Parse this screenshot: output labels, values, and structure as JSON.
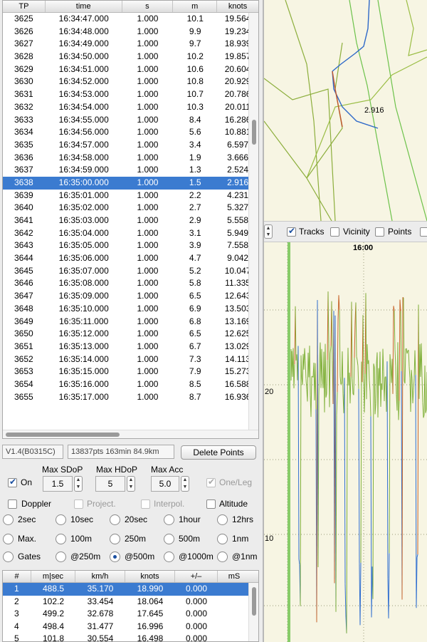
{
  "points_table": {
    "columns": [
      "TP",
      "time",
      "s",
      "m",
      "knots"
    ],
    "selected_tp": "3638",
    "rows": [
      [
        "3625",
        "16:34:47.000",
        "1.000",
        "10.1",
        "19.564"
      ],
      [
        "3626",
        "16:34:48.000",
        "1.000",
        "9.9",
        "19.234"
      ],
      [
        "3627",
        "16:34:49.000",
        "1.000",
        "9.7",
        "18.939"
      ],
      [
        "3628",
        "16:34:50.000",
        "1.000",
        "10.2",
        "19.857"
      ],
      [
        "3629",
        "16:34:51.000",
        "1.000",
        "10.6",
        "20.604"
      ],
      [
        "3630",
        "16:34:52.000",
        "1.000",
        "10.8",
        "20.929"
      ],
      [
        "3631",
        "16:34:53.000",
        "1.000",
        "10.7",
        "20.786"
      ],
      [
        "3632",
        "16:34:54.000",
        "1.000",
        "10.3",
        "20.011"
      ],
      [
        "3633",
        "16:34:55.000",
        "1.000",
        "8.4",
        "16.286"
      ],
      [
        "3634",
        "16:34:56.000",
        "1.000",
        "5.6",
        "10.881"
      ],
      [
        "3635",
        "16:34:57.000",
        "1.000",
        "3.4",
        "6.597"
      ],
      [
        "3636",
        "16:34:58.000",
        "1.000",
        "1.9",
        "3.666"
      ],
      [
        "3637",
        "16:34:59.000",
        "1.000",
        "1.3",
        "2.524"
      ],
      [
        "3638",
        "16:35:00.000",
        "1.000",
        "1.5",
        "2.916"
      ],
      [
        "3639",
        "16:35:01.000",
        "1.000",
        "2.2",
        "4.231"
      ],
      [
        "3640",
        "16:35:02.000",
        "1.000",
        "2.7",
        "5.327"
      ],
      [
        "3641",
        "16:35:03.000",
        "1.000",
        "2.9",
        "5.558"
      ],
      [
        "3642",
        "16:35:04.000",
        "1.000",
        "3.1",
        "5.949"
      ],
      [
        "3643",
        "16:35:05.000",
        "1.000",
        "3.9",
        "7.558"
      ],
      [
        "3644",
        "16:35:06.000",
        "1.000",
        "4.7",
        "9.042"
      ],
      [
        "3645",
        "16:35:07.000",
        "1.000",
        "5.2",
        "10.047"
      ],
      [
        "3646",
        "16:35:08.000",
        "1.000",
        "5.8",
        "11.335"
      ],
      [
        "3647",
        "16:35:09.000",
        "1.000",
        "6.5",
        "12.643"
      ],
      [
        "3648",
        "16:35:10.000",
        "1.000",
        "6.9",
        "13.503"
      ],
      [
        "3649",
        "16:35:11.000",
        "1.000",
        "6.8",
        "13.169"
      ],
      [
        "3650",
        "16:35:12.000",
        "1.000",
        "6.5",
        "12.625"
      ],
      [
        "3651",
        "16:35:13.000",
        "1.000",
        "6.7",
        "13.029"
      ],
      [
        "3652",
        "16:35:14.000",
        "1.000",
        "7.3",
        "14.113"
      ],
      [
        "3653",
        "16:35:15.000",
        "1.000",
        "7.9",
        "15.273"
      ],
      [
        "3654",
        "16:35:16.000",
        "1.000",
        "8.5",
        "16.588"
      ],
      [
        "3655",
        "16:35:17.000",
        "1.000",
        "8.7",
        "16.936"
      ]
    ]
  },
  "info": {
    "version": "V1.4(B0315C)",
    "stats": "13837pts 163min 84.9km",
    "delete_button": "Delete Points"
  },
  "filters": {
    "on_label": "On",
    "on_checked": true,
    "sdop_label": "Max SDoP",
    "sdop_value": "1.5",
    "hdop_label": "Max HDoP",
    "hdop_value": "5",
    "acc_label": "Max Acc",
    "acc_value": "5.0",
    "one_leg_label": "One/Leg",
    "one_leg_checked": true,
    "doppler_label": "Doppler",
    "project_label": "Project.",
    "interpol_label": "Interpol.",
    "altitude_label": "Altitude"
  },
  "radio_options": {
    "row1": [
      "2sec",
      "10sec",
      "20sec",
      "1hour",
      "12hrs"
    ],
    "row2": [
      "Max.",
      "100m",
      "250m",
      "500m",
      "1nm"
    ],
    "row3": [
      "Gates",
      "@250m",
      "@500m",
      "@1000m",
      "@1nm"
    ],
    "selected": "@500m"
  },
  "laps_table": {
    "columns": [
      "#",
      "m|sec",
      "km/h",
      "knots",
      "+/–",
      "mS"
    ],
    "rows": [
      [
        "1",
        "488.5",
        "35.170",
        "18.990",
        "0.000"
      ],
      [
        "2",
        "102.2",
        "33.454",
        "18.064",
        "0.000"
      ],
      [
        "3",
        "499.2",
        "32.678",
        "17.645",
        "0.000"
      ],
      [
        "4",
        "498.4",
        "31.477",
        "16.996",
        "0.000"
      ],
      [
        "5",
        "101.8",
        "30.554",
        "16.498",
        "0.000"
      ]
    ],
    "selected_index": 0
  },
  "map": {
    "point_label": "2.916"
  },
  "map_toolbar": {
    "tracks_label": "Tracks",
    "tracks_checked": true,
    "vicinity_label": "Vicinity",
    "points_label": "Points"
  },
  "chart_data": {
    "type": "line",
    "x_tick_labels": [
      "16:00"
    ],
    "y_tick_labels": [
      "20",
      "10"
    ],
    "colors": {
      "high": "#c8642a",
      "mid": "#7fb03a",
      "low": "#2f6ed0",
      "grid": "#9a9a7a"
    }
  }
}
